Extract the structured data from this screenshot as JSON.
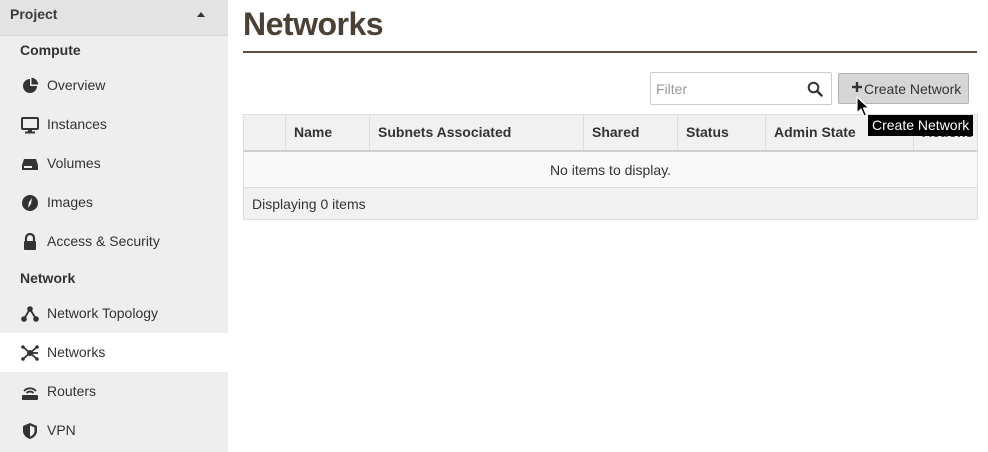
{
  "sidebar": {
    "project_label": "Project",
    "sections": {
      "compute": "Compute",
      "network": "Network"
    },
    "items": [
      {
        "label": "Overview",
        "icon": "pie-chart-icon"
      },
      {
        "label": "Instances",
        "icon": "desktop-icon"
      },
      {
        "label": "Volumes",
        "icon": "hdd-icon"
      },
      {
        "label": "Images",
        "icon": "compass-icon"
      },
      {
        "label": "Access & Security",
        "icon": "lock-icon"
      },
      {
        "label": "Network Topology",
        "icon": "topology-icon"
      },
      {
        "label": "Networks",
        "icon": "network-icon",
        "active": true
      },
      {
        "label": "Routers",
        "icon": "router-icon"
      },
      {
        "label": "VPN",
        "icon": "shield-icon"
      }
    ]
  },
  "main": {
    "title": "Networks",
    "filter": {
      "placeholder": "Filter",
      "value": ""
    },
    "create_button_label": "Create Network",
    "table": {
      "columns": [
        "Name",
        "Subnets Associated",
        "Shared",
        "Status",
        "Admin State",
        "Actions"
      ],
      "empty_text": "No items to display.",
      "footer_text": "Displaying 0 items"
    },
    "tooltip": "Create Network"
  },
  "colors": {
    "sidebar_bg": "#eeeeee",
    "active_bg": "#ffffff",
    "title": "#4b4035",
    "button_bg": "#d6d6d6"
  }
}
